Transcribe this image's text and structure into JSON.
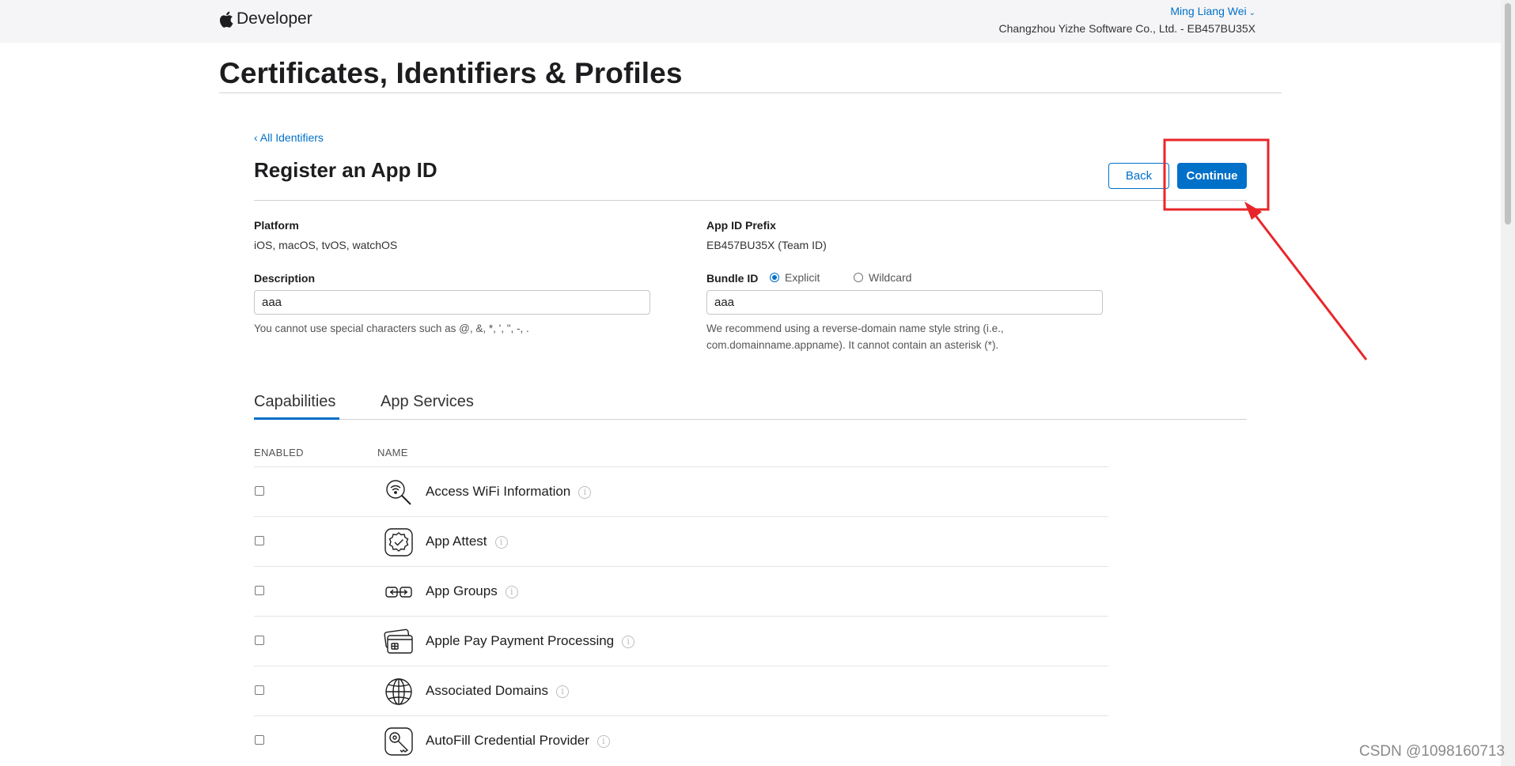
{
  "header": {
    "logo_text": "Developer",
    "account_name": "Ming Liang Wei",
    "account_org": "Changzhou Yizhe Software Co., Ltd. - EB457BU35X"
  },
  "page_title": "Certificates, Identifiers & Profiles",
  "nav": {
    "back_link": "‹ All Identifiers"
  },
  "form": {
    "title": "Register an App ID",
    "back_label": "Back",
    "continue_label": "Continue",
    "platform_label": "Platform",
    "platform_value": "iOS, macOS, tvOS, watchOS",
    "prefix_label": "App ID Prefix",
    "prefix_value": "EB457BU35X (Team ID)",
    "description_label": "Description",
    "description_value": "aaa",
    "description_hint": "You cannot use special characters such as @, &, *, ', \", -, .",
    "bundle_label": "Bundle ID",
    "bundle_explicit": "Explicit",
    "bundle_wildcard": "Wildcard",
    "bundle_selected": "Explicit",
    "bundle_value": "aaa",
    "bundle_hint_1": "We recommend using a reverse-domain name style string (i.e.,",
    "bundle_hint_2": "com.domainname.appname). It cannot contain an asterisk (*)."
  },
  "tabs": [
    "Capabilities",
    "App Services"
  ],
  "active_tab": "Capabilities",
  "table": {
    "col_enabled": "ENABLED",
    "col_name": "NAME",
    "rows": [
      {
        "name": "Access WiFi Information",
        "icon": "wifi-search-icon",
        "enabled": false
      },
      {
        "name": "App Attest",
        "icon": "seal-check-icon",
        "enabled": false
      },
      {
        "name": "App Groups",
        "icon": "app-groups-icon",
        "enabled": false
      },
      {
        "name": "Apple Pay Payment Processing",
        "icon": "wallet-card-icon",
        "enabled": false
      },
      {
        "name": "Associated Domains",
        "icon": "globe-icon",
        "enabled": false
      },
      {
        "name": "AutoFill Credential Provider",
        "icon": "key-icon",
        "enabled": false
      }
    ]
  },
  "watermark": "CSDN @1098160713",
  "colors": {
    "accent": "#0070c9",
    "annotation": "#e8262a"
  }
}
